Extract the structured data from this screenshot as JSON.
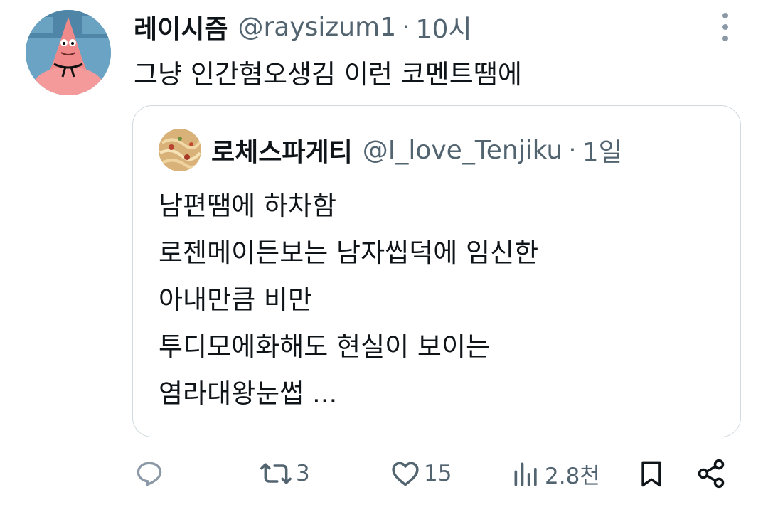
{
  "tweet": {
    "author_name": "레이시즘",
    "handle": "@raysizum1",
    "separator": "·",
    "time": "10시",
    "text": "그냥 인간혐오생김 이런 코멘트땜에"
  },
  "quoted": {
    "author_name": "로체스파게티",
    "handle": "@I_love_Tenjiku",
    "separator": "·",
    "time": "1일",
    "lines": [
      "남편땜에 하차함",
      "로젠메이든보는 남자씹덕에 임신한",
      "아내만큼 비만",
      "투디모에화해도 현실이 보이는",
      "염라대왕눈썹 ..."
    ]
  },
  "actions": {
    "reply_icon": "reply-icon",
    "retweet_icon": "retweet-icon",
    "retweet_count": "3",
    "like_icon": "heart-icon",
    "like_count": "15",
    "views_icon": "views-icon",
    "views_count": "2.8천",
    "bookmark_icon": "bookmark-icon",
    "share_icon": "share-icon"
  },
  "colors": {
    "text": "#0f1419",
    "secondary": "#536471",
    "border": "#cfd9de"
  }
}
